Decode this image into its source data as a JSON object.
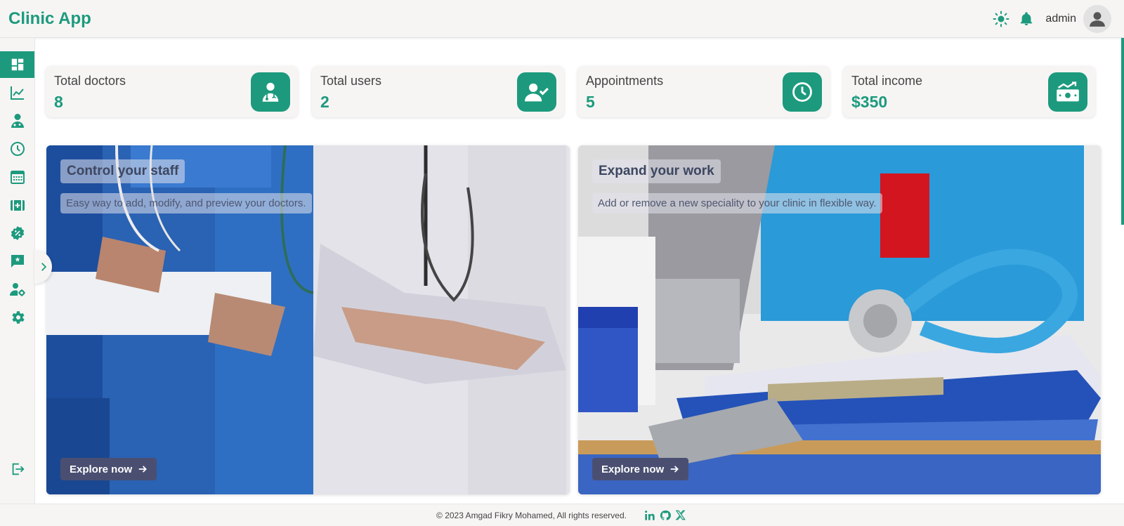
{
  "app": {
    "title": "Clinic App"
  },
  "header": {
    "username": "admin"
  },
  "sidebar": {
    "items": [
      {
        "name": "dashboard",
        "icon": "dashboard-icon",
        "active": true
      },
      {
        "name": "statistics",
        "icon": "chart-line-icon",
        "active": false
      },
      {
        "name": "doctors",
        "icon": "doctor-icon",
        "active": false
      },
      {
        "name": "appointments",
        "icon": "clock-icon",
        "active": false
      },
      {
        "name": "calendar",
        "icon": "calendar-icon",
        "active": false
      },
      {
        "name": "specialities",
        "icon": "medical-kit-icon",
        "active": false
      },
      {
        "name": "discounts",
        "icon": "discount-badge-icon",
        "active": false
      },
      {
        "name": "feedback",
        "icon": "feedback-icon",
        "active": false
      },
      {
        "name": "users",
        "icon": "user-settings-icon",
        "active": false
      },
      {
        "name": "settings",
        "icon": "gear-icon",
        "active": false
      }
    ],
    "logout": {
      "icon": "logout-icon"
    }
  },
  "stats": [
    {
      "label": "Total doctors",
      "value": "8",
      "icon": "doctor-icon"
    },
    {
      "label": "Total users",
      "value": "2",
      "icon": "user-check-icon"
    },
    {
      "label": "Appointments",
      "value": "5",
      "icon": "clock-icon"
    },
    {
      "label": "Total income",
      "value": "$350",
      "icon": "money-growth-icon"
    }
  ],
  "banners": [
    {
      "title": "Control your staff",
      "subtitle": "Easy way to add, modify, and preview your doctors.",
      "button": "Explore now"
    },
    {
      "title": "Expand your work",
      "subtitle": "Add or remove a new speciality to your clinic in flexible way.",
      "button": "Explore now"
    }
  ],
  "footer": {
    "copyright": "© 2023 Amgad Fikry Mohamed, All rights reserved.",
    "links": [
      "linkedin-icon",
      "github-icon",
      "x-icon"
    ]
  },
  "colors": {
    "accent": "#1d9a7d",
    "button": "#4a4f72",
    "background": "#f6f5f4"
  }
}
